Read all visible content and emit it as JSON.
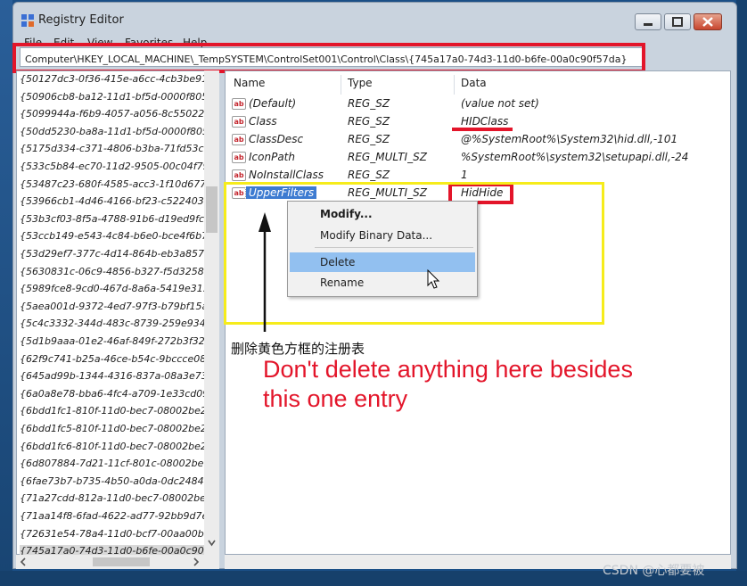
{
  "window": {
    "title": "Registry Editor",
    "menu": [
      "File",
      "Edit",
      "View",
      "Favorites",
      "Help"
    ]
  },
  "address": {
    "path": "Computer\\HKEY_LOCAL_MACHINE\\_TempSYSTEM\\ControlSet001\\Control\\Class\\{745a17a0-74d3-11d0-b6fe-00a0c90f57da}"
  },
  "tree": {
    "items": [
      "{50127dc3-0f36-415e-a6cc-4cb3be91",
      "{50906cb8-ba12-11d1-bf5d-0000f805",
      "{5099944a-f6b9-4057-a056-8c550228",
      "{50dd5230-ba8a-11d1-bf5d-0000f805",
      "{5175d334-c371-4806-b3ba-71fd53c9",
      "{533c5b84-ec70-11d2-9505-00c04f79",
      "{53487c23-680f-4585-acc3-1f10d677",
      "{53966cb1-4d46-4166-bf23-c522403c",
      "{53b3cf03-8f5a-4788-91b6-d19ed9fc",
      "{53ccb149-e543-4c84-b6e0-bce4f6b7e",
      "{53d29ef7-377c-4d14-864b-eb3a8576",
      "{5630831c-06c9-4856-b327-f5d32586e",
      "{5989fce8-9cd0-467d-8a6a-5419e315",
      "{5aea001d-9372-4ed7-97f3-b79bf15a",
      "{5c4c3332-344d-483c-8739-259e934c9",
      "{5d1b9aaa-01e2-46af-849f-272b3f32",
      "{62f9c741-b25a-46ce-b54c-9bccce08b",
      "{645ad99b-1344-4316-837a-08a3e73",
      "{6a0a8e78-bba6-4fc4-a709-1e33cd09",
      "{6bdd1fc1-810f-11d0-bec7-08002be2",
      "{6bdd1fc5-810f-11d0-bec7-08002be2",
      "{6bdd1fc6-810f-11d0-bec7-08002be2",
      "{6d807884-7d21-11cf-801c-08002be1",
      "{6fae73b7-b735-4b50-a0da-0dc2484",
      "{71a27cdd-812a-11d0-bec7-08002be2",
      "{71aa14f8-6fad-4622-ad77-92bb9d7e",
      "{72631e54-78a4-11d0-bcf7-00aa00b7",
      "{745a17a0-74d3-11d0-b6fe-00a0c90f"
    ]
  },
  "list": {
    "columns": [
      "Name",
      "Type",
      "Data"
    ],
    "rows": [
      {
        "name": "(Default)",
        "type": "REG_SZ",
        "data": "(value not set)"
      },
      {
        "name": "Class",
        "type": "REG_SZ",
        "data": "HIDClass"
      },
      {
        "name": "ClassDesc",
        "type": "REG_SZ",
        "data": "@%SystemRoot%\\System32\\hid.dll,-101"
      },
      {
        "name": "IconPath",
        "type": "REG_MULTI_SZ",
        "data": "%SystemRoot%\\system32\\setupapi.dll,-24"
      },
      {
        "name": "NoInstallClass",
        "type": "REG_SZ",
        "data": "1"
      },
      {
        "name": "UpperFilters",
        "type": "REG_MULTI_SZ",
        "data": "HidHide"
      }
    ],
    "icon_label": "ab"
  },
  "context_menu": {
    "items": [
      "Modify...",
      "Modify Binary Data...",
      "Delete",
      "Rename"
    ]
  },
  "annotations": {
    "cn": "删除黄色方框的注册表",
    "en_line1": "Don't delete anything here besides",
    "en_line2": "this one entry"
  },
  "watermark": "CSDN @心都要被",
  "colors": {
    "highlight_red": "#e3152a",
    "highlight_yellow": "#f6ec1b",
    "selection_blue": "#3d7bd1",
    "menu_hover": "#92c0f0"
  }
}
